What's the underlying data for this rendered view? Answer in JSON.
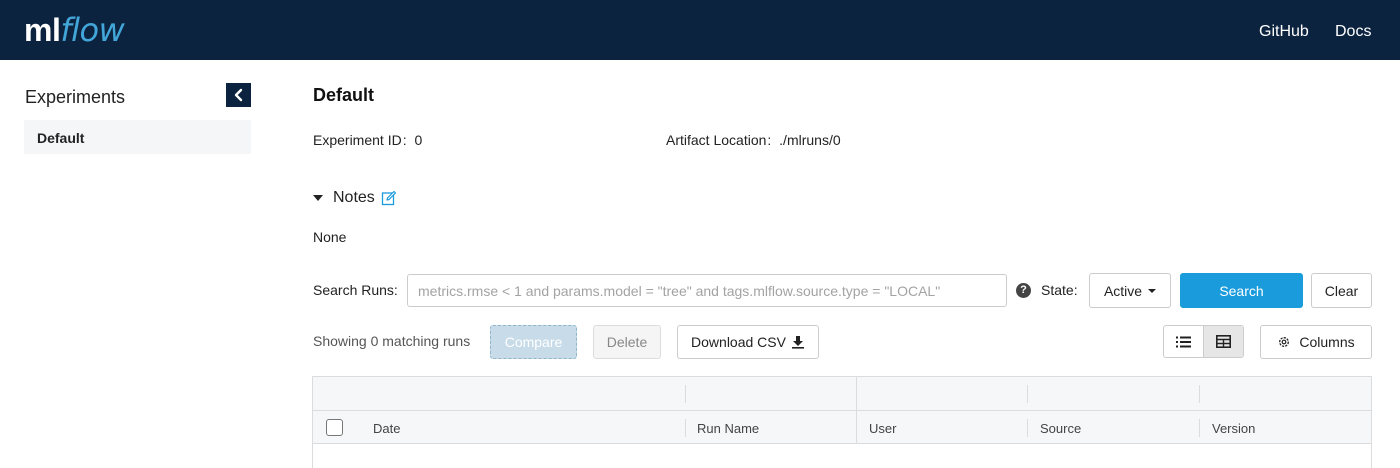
{
  "brand": {
    "prefix": "ml",
    "suffix": "flow"
  },
  "nav": {
    "github": "GitHub",
    "docs": "Docs"
  },
  "sidebar": {
    "title": "Experiments",
    "collapse_icon": "chevron-left-icon",
    "items": [
      {
        "label": "Default",
        "selected": true
      }
    ]
  },
  "experiment": {
    "title": "Default",
    "id_label": "Experiment ID",
    "id_value": "0",
    "artifact_label": "Artifact Location",
    "artifact_value": "./mlruns/0",
    "separator": ":"
  },
  "notes": {
    "label": "Notes",
    "value": "None",
    "edit_icon": "edit-icon",
    "expanded": true
  },
  "search": {
    "label": "Search Runs:",
    "placeholder": "metrics.rmse < 1 and params.model = \"tree\" and tags.mlflow.source.type = \"LOCAL\"",
    "value": "",
    "help": "?",
    "state_label": "State:",
    "state_value": "Active",
    "search_button": "Search",
    "clear_button": "Clear"
  },
  "runs_toolbar": {
    "showing_text": "Showing 0 matching runs",
    "compare": "Compare",
    "delete": "Delete",
    "download_csv": "Download CSV",
    "download_icon": "download-icon",
    "list_view_icon": "list-view-icon",
    "grid_view_icon": "grid-view-icon",
    "columns": "Columns",
    "columns_icon": "gear-icon"
  },
  "table": {
    "columns": [
      "Date",
      "Run Name",
      "User",
      "Source",
      "Version"
    ],
    "rows": []
  },
  "colors": {
    "header_bg": "#0c2340",
    "accent": "#1a9bdb",
    "logo_flow": "#43a6d9"
  }
}
